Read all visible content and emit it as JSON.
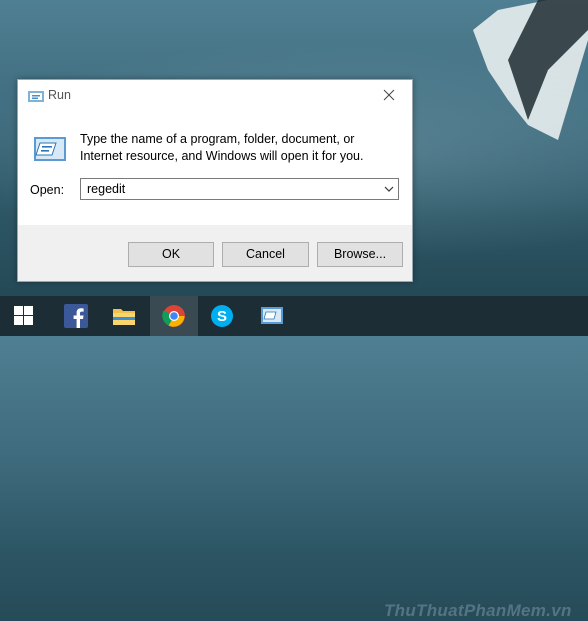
{
  "dialog": {
    "title": "Run",
    "description": "Type the name of a program, folder, document, or Internet resource, and Windows will open it for you.",
    "open_label": "Open:",
    "open_value": "regedit",
    "buttons": {
      "ok": "OK",
      "cancel": "Cancel",
      "browse": "Browse..."
    }
  },
  "taskbar": {
    "items": [
      "start-windows-icon",
      "facebook-icon",
      "file-explorer-icon",
      "chrome-icon",
      "skype-icon",
      "run-icon"
    ],
    "active_item": "chrome-icon"
  },
  "watermark": "ThuThuatPhanMem.vn",
  "colors": {
    "taskbar": "#1c2d36",
    "facebook": "#3b5998",
    "skype": "#00aff0",
    "dialog_bg": "#f0f0f0"
  }
}
